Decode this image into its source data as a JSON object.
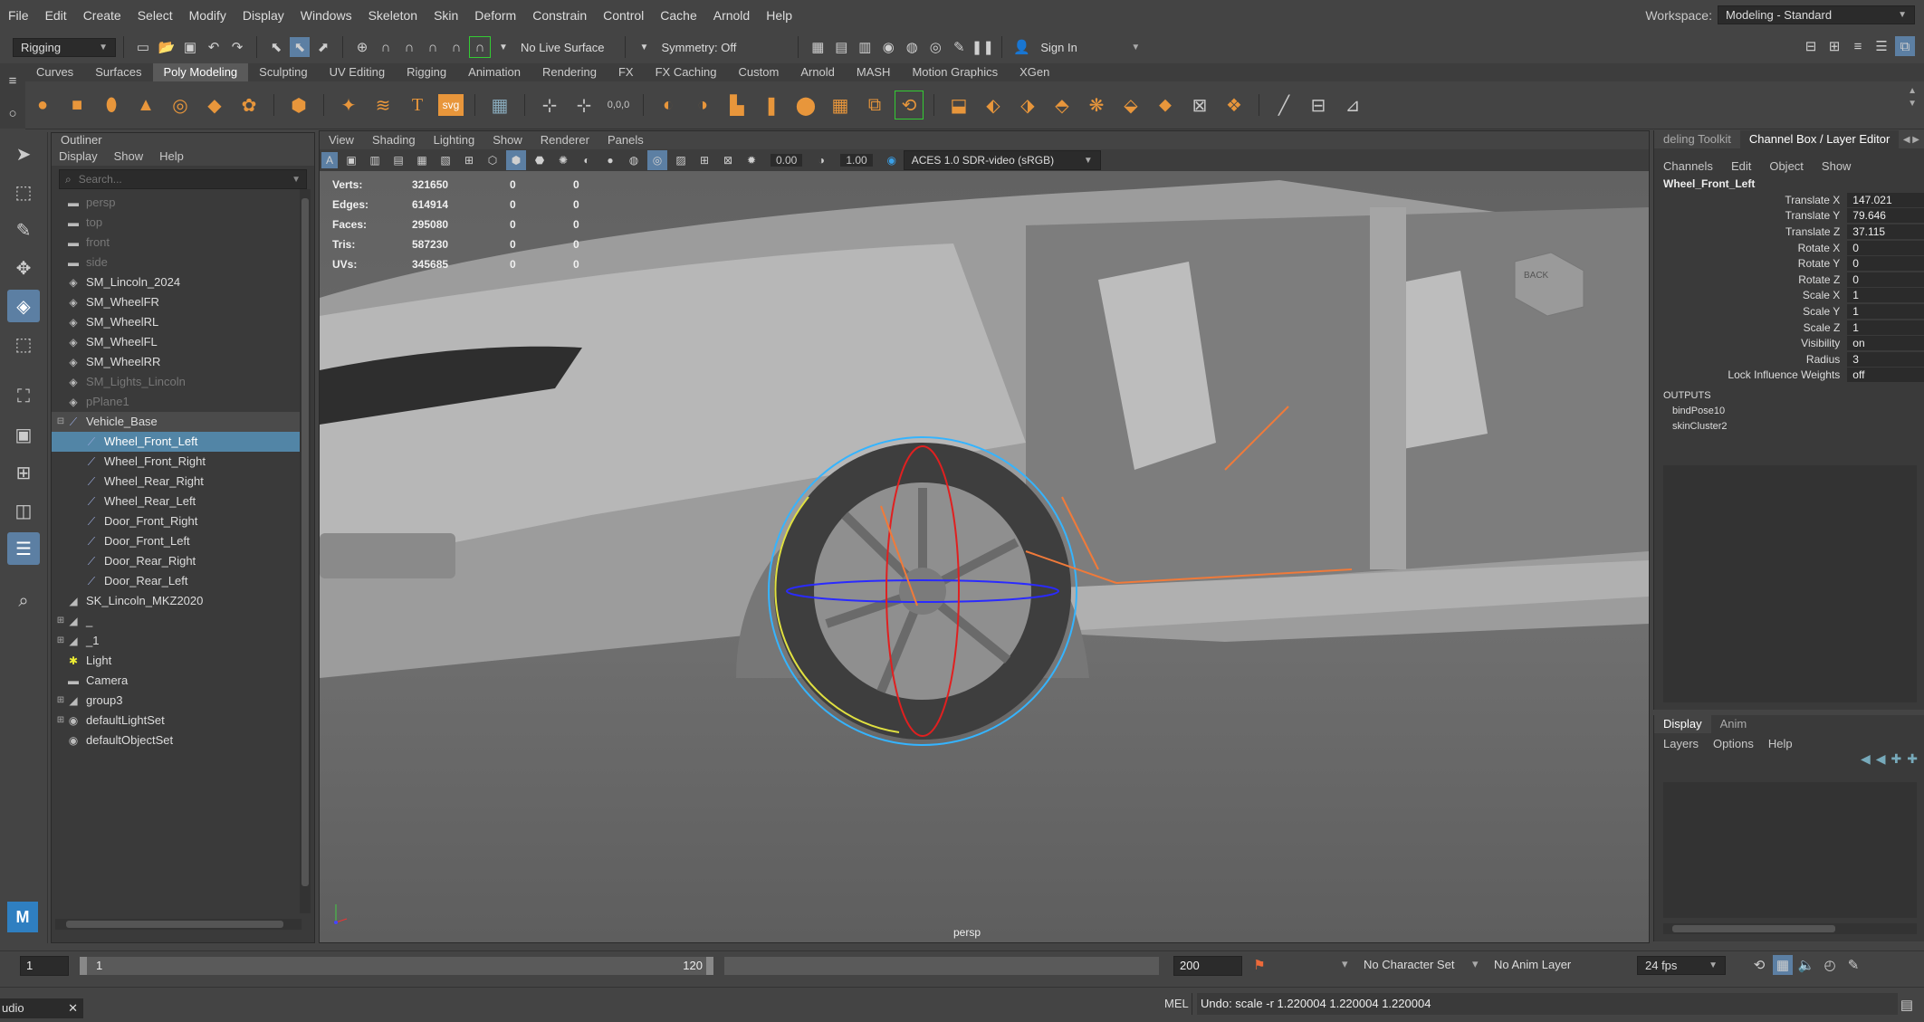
{
  "menubar": {
    "items": [
      "File",
      "Edit",
      "Create",
      "Select",
      "Modify",
      "Display",
      "Windows",
      "Skeleton",
      "Skin",
      "Deform",
      "Constrain",
      "Control",
      "Cache",
      "Arnold",
      "Help"
    ],
    "workspace_label": "Workspace:",
    "workspace_value": "Modeling - Standard"
  },
  "statusline": {
    "mode": "Rigging",
    "live_surface": "No Live Surface",
    "symmetry": "Symmetry: Off",
    "sign_in": "Sign In"
  },
  "shelf": {
    "tabs": [
      "Curves",
      "Surfaces",
      "Poly Modeling",
      "Sculpting",
      "UV Editing",
      "Rigging",
      "Animation",
      "Rendering",
      "FX",
      "FX Caching",
      "Custom",
      "Arnold",
      "MASH",
      "Motion Graphics",
      "XGen"
    ],
    "active_tab": "Poly Modeling",
    "svg_label": "svg",
    "snap_readout": "0,0,0"
  },
  "outliner": {
    "title": "Outliner",
    "menus": [
      "Display",
      "Show",
      "Help"
    ],
    "search_placeholder": "Search...",
    "items": [
      {
        "label": "persp",
        "dim": true,
        "indent": 0,
        "glyph": "camera"
      },
      {
        "label": "top",
        "dim": true,
        "indent": 0,
        "glyph": "camera"
      },
      {
        "label": "front",
        "dim": true,
        "indent": 0,
        "glyph": "camera"
      },
      {
        "label": "side",
        "dim": true,
        "indent": 0,
        "glyph": "camera"
      },
      {
        "label": "SM_Lincoln_2024",
        "dim": false,
        "indent": 0,
        "glyph": "mesh"
      },
      {
        "label": "SM_WheelFR",
        "dim": false,
        "indent": 0,
        "glyph": "mesh"
      },
      {
        "label": "SM_WheelRL",
        "dim": false,
        "indent": 0,
        "glyph": "mesh"
      },
      {
        "label": "SM_WheelFL",
        "dim": false,
        "indent": 0,
        "glyph": "mesh"
      },
      {
        "label": "SM_WheelRR",
        "dim": false,
        "indent": 0,
        "glyph": "mesh"
      },
      {
        "label": "SM_Lights_Lincoln",
        "dim": true,
        "indent": 0,
        "glyph": "mesh"
      },
      {
        "label": "pPlane1",
        "dim": true,
        "indent": 0,
        "glyph": "mesh"
      },
      {
        "label": "Vehicle_Base",
        "dim": false,
        "indent": 0,
        "glyph": "joint",
        "expand": "−",
        "highlight": true
      },
      {
        "label": "Wheel_Front_Left",
        "dim": false,
        "indent": 1,
        "glyph": "joint",
        "selected": true
      },
      {
        "label": "Wheel_Front_Right",
        "dim": false,
        "indent": 1,
        "glyph": "joint"
      },
      {
        "label": "Wheel_Rear_Right",
        "dim": false,
        "indent": 1,
        "glyph": "joint"
      },
      {
        "label": "Wheel_Rear_Left",
        "dim": false,
        "indent": 1,
        "glyph": "joint"
      },
      {
        "label": "Door_Front_Right",
        "dim": false,
        "indent": 1,
        "glyph": "joint"
      },
      {
        "label": "Door_Front_Left",
        "dim": false,
        "indent": 1,
        "glyph": "joint"
      },
      {
        "label": "Door_Rear_Right",
        "dim": false,
        "indent": 1,
        "glyph": "joint"
      },
      {
        "label": "Door_Rear_Left",
        "dim": false,
        "indent": 1,
        "glyph": "joint"
      },
      {
        "label": "SK_Lincoln_MKZ2020",
        "dim": false,
        "indent": 0,
        "glyph": "skin"
      },
      {
        "label": "_",
        "dim": false,
        "indent": 0,
        "glyph": "skin",
        "expand": "+"
      },
      {
        "label": "_1",
        "dim": false,
        "indent": 0,
        "glyph": "skin",
        "expand": "+"
      },
      {
        "label": "Light",
        "dim": false,
        "indent": 0,
        "glyph": "light"
      },
      {
        "label": "Camera",
        "dim": false,
        "indent": 0,
        "glyph": "camera"
      },
      {
        "label": "group3",
        "dim": false,
        "indent": 0,
        "glyph": "skin",
        "expand": "+"
      },
      {
        "label": "defaultLightSet",
        "dim": false,
        "indent": 0,
        "glyph": "set",
        "expand": "+"
      },
      {
        "label": "defaultObjectSet",
        "dim": false,
        "indent": 0,
        "glyph": "set"
      }
    ]
  },
  "viewport": {
    "menus": [
      "View",
      "Shading",
      "Lighting",
      "Show",
      "Renderer",
      "Panels"
    ],
    "near_value": "0.00",
    "far_value": "1.00",
    "color_space": "ACES 1.0 SDR-video (sRGB)",
    "hud": [
      {
        "label": "Verts:",
        "a": "321650",
        "b": "0",
        "c": "0"
      },
      {
        "label": "Edges:",
        "a": "614914",
        "b": "0",
        "c": "0"
      },
      {
        "label": "Faces:",
        "a": "295080",
        "b": "0",
        "c": "0"
      },
      {
        "label": "Tris:",
        "a": "587230",
        "b": "0",
        "c": "0"
      },
      {
        "label": "UVs:",
        "a": "345685",
        "b": "0",
        "c": "0"
      }
    ],
    "camera_label": "persp",
    "viewcube_label": "BACK"
  },
  "channelbox": {
    "tabs": [
      "deling Toolkit",
      "Channel Box / Layer Editor"
    ],
    "menus": [
      "Channels",
      "Edit",
      "Object",
      "Show"
    ],
    "object": "Wheel_Front_Left",
    "channels": [
      {
        "label": "Translate X",
        "value": "147.021"
      },
      {
        "label": "Translate Y",
        "value": "79.646"
      },
      {
        "label": "Translate Z",
        "value": "37.115"
      },
      {
        "label": "Rotate X",
        "value": "0"
      },
      {
        "label": "Rotate Y",
        "value": "0"
      },
      {
        "label": "Rotate Z",
        "value": "0"
      },
      {
        "label": "Scale X",
        "value": "1"
      },
      {
        "label": "Scale Y",
        "value": "1"
      },
      {
        "label": "Scale Z",
        "value": "1"
      },
      {
        "label": "Visibility",
        "value": "on"
      },
      {
        "label": "Radius",
        "value": "3"
      },
      {
        "label": "Lock Influence Weights",
        "value": "off"
      }
    ],
    "outputs_label": "OUTPUTS",
    "outputs": [
      "bindPose10",
      "skinCluster2"
    ]
  },
  "layereditor": {
    "tabs": [
      "Display",
      "Anim"
    ],
    "menus": [
      "Layers",
      "Options",
      "Help"
    ]
  },
  "timeslider": {
    "start": "1",
    "range_start": "1",
    "range_end": "120",
    "end": "200",
    "character_set": "No Character Set",
    "anim_layer": "No Anim Layer",
    "fps": "24 fps"
  },
  "commandline": {
    "left_text": "udio",
    "lang": "MEL",
    "feedback": "Undo: scale -r 1.220004 1.220004 1.220004"
  }
}
